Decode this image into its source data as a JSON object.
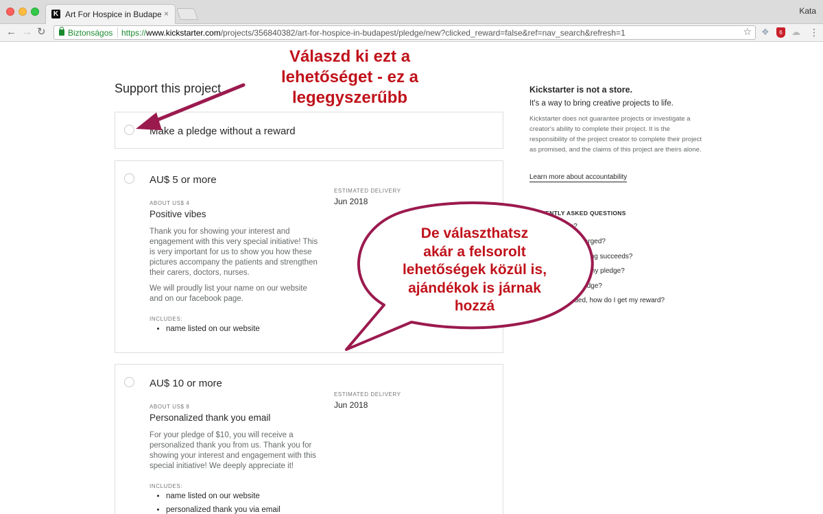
{
  "browser": {
    "tab_title": "Art For Hospice in Budapest",
    "tab_close": "×",
    "user": "Kata",
    "secure_label": "Biztonságos",
    "url_scheme": "https://",
    "url_host": "www.kickstarter.com",
    "url_path": "/projects/356840382/art-for-hospice-in-budapest/pledge/new?clicked_reward=false&ref=nav_search&refresh=1",
    "icons": {
      "back": "←",
      "forward": "→",
      "reload": "↻",
      "star": "☆",
      "dropbox": "❖",
      "shield": "6",
      "cloud": "☁",
      "menu": "⋮",
      "favicon": "K"
    }
  },
  "page": {
    "title": "Support this project",
    "no_reward_label": "Make a pledge without a reward",
    "estimated_delivery_label": "ESTIMATED DELIVERY",
    "includes_label": "INCLUDES:",
    "rewards": [
      {
        "amount": "AU$ 5 or more",
        "about": "ABOUT US$ 4",
        "delivery": "Jun 2018",
        "name": "Positive vibes",
        "desc1": "Thank you for showing your interest and engagement with this very special initiative! This is very important for us to show you how these pictures accompany the patients and strengthen their carers, doctors, nurses.",
        "desc2": "We will proudly list your name on our website and on our facebook page.",
        "includes": [
          "name listed on our website"
        ]
      },
      {
        "amount": "AU$ 10 or more",
        "about": "ABOUT US$ 8",
        "delivery": "Jun 2018",
        "name": "Personalized thank you email",
        "desc1": "For your pledge of $10, you will receive a personalized thank you from us. Thank you for showing your interest and engagement with this special initiative! We deeply appreciate it!",
        "includes": [
          "name listed on our website",
          "personalized thank you via email"
        ]
      }
    ]
  },
  "sidebar": {
    "heading": "Kickstarter is not a store.",
    "subheading": "It's a way to bring creative projects to life.",
    "text": "Kickstarter does not guarantee projects or investigate a creator's ability to complete their project. It is the responsibility of the project creator to complete their project as promised, and the claims of this project are theirs alone.",
    "link": "Learn more about accountability",
    "faq_heading": "FREQUENTLY ASKED QUESTIONS",
    "faq": [
      "How do I pledge?",
      "When is my card charged?",
      "What happens if funding succeeds?",
      "How do I learn about my pledge?",
      "Can I change my pledge?",
      "If a project is funded, how do I get my reward?"
    ]
  },
  "annotations": {
    "top_lines": [
      "Válaszd ki ezt a",
      "lehetőséget - ez a",
      "legegyszerűbb"
    ],
    "bubble_lines": [
      "De választhatsz",
      "akár a felsorolt",
      "lehetőségek közül is,",
      "ajándékok is járnak",
      "hozzá"
    ],
    "color": "#c0121b",
    "arrow_color": "#9b1a4e"
  }
}
